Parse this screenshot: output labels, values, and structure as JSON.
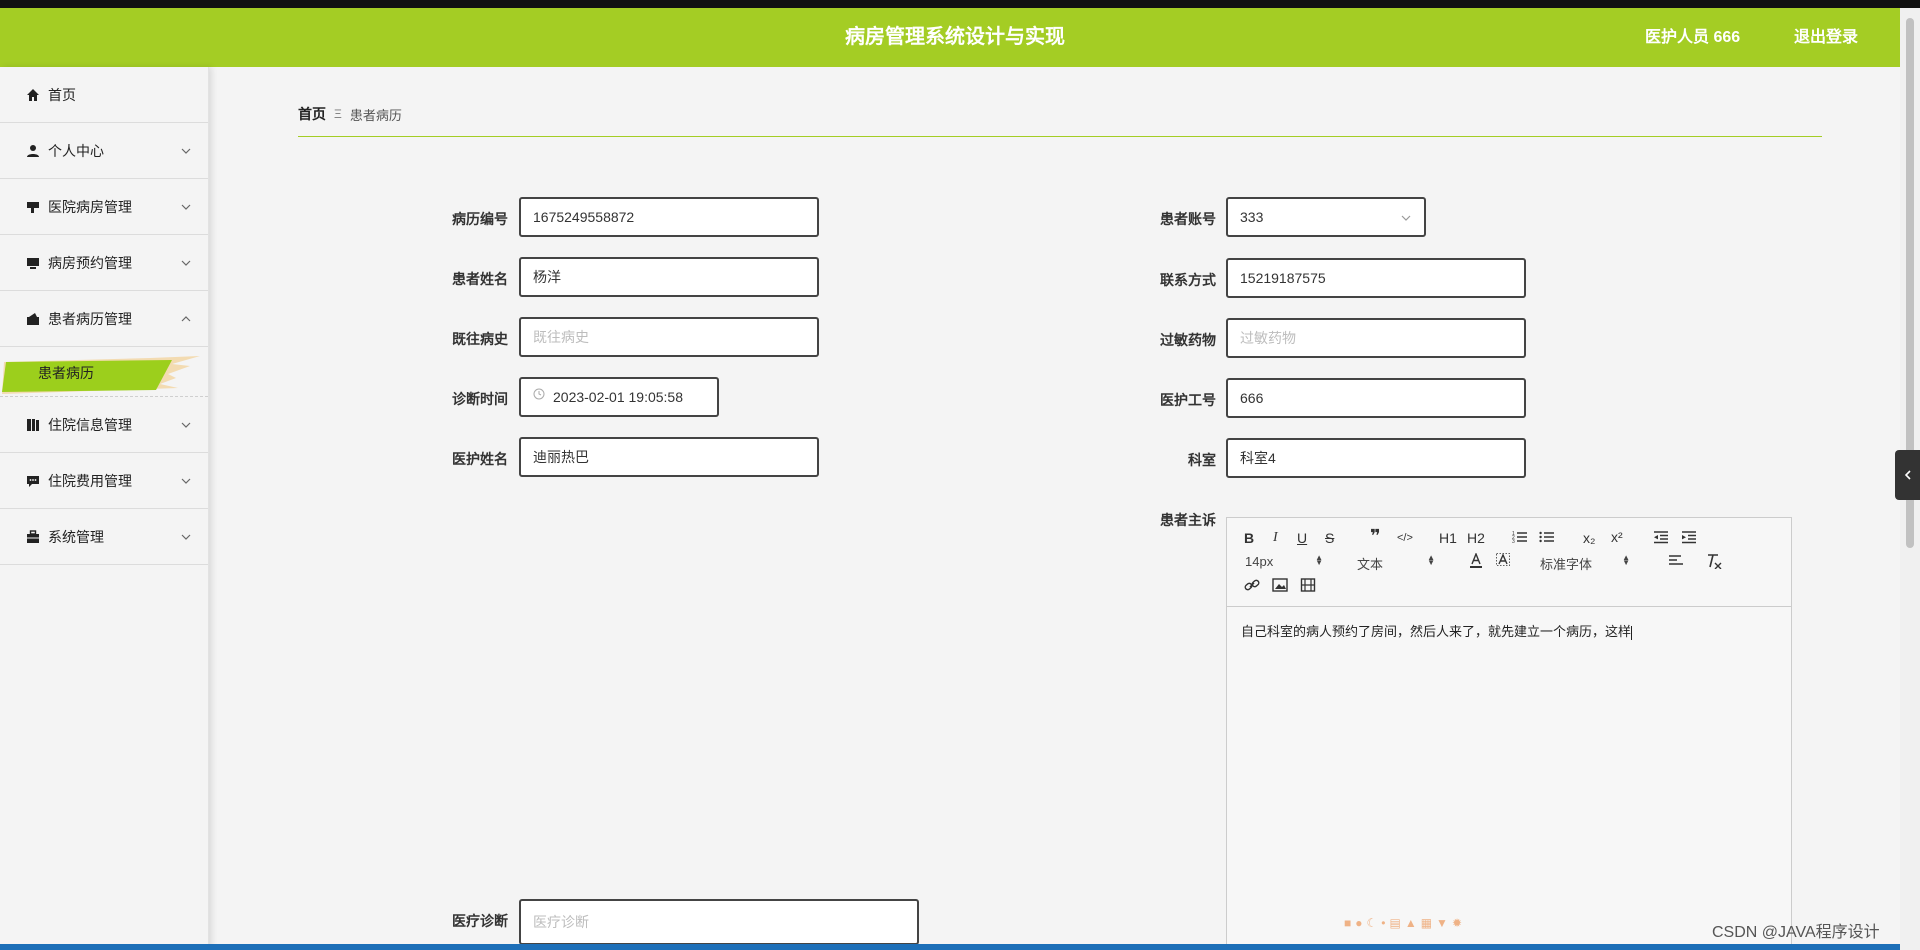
{
  "header": {
    "title": "病房管理系统设计与实现",
    "user": "医护人员 666",
    "logout": "退出登录"
  },
  "sidebar": {
    "items": [
      {
        "label": "首页",
        "icon": "home-icon"
      },
      {
        "label": "个人中心",
        "icon": "user-icon"
      },
      {
        "label": "医院病房管理",
        "icon": "flag-icon"
      },
      {
        "label": "病房预约管理",
        "icon": "monitor-icon"
      },
      {
        "label": "患者病历管理",
        "icon": "wallet-icon"
      },
      {
        "label": "住院信息管理",
        "icon": "book-icon"
      },
      {
        "label": "住院费用管理",
        "icon": "chat-icon"
      },
      {
        "label": "系统管理",
        "icon": "briefcase-icon"
      }
    ],
    "submenu_active": "患者病历"
  },
  "breadcrumb": {
    "home": "首页",
    "separator": "Ξ",
    "current": "患者病历"
  },
  "form": {
    "record_no": {
      "label": "病历编号",
      "value": "1675249558872"
    },
    "patient_name": {
      "label": "患者姓名",
      "value": "杨洋"
    },
    "history": {
      "label": "既往病史",
      "placeholder": "既往病史"
    },
    "diagnosis_time": {
      "label": "诊断时间",
      "value": "2023-02-01 19:05:58"
    },
    "nurse_name": {
      "label": "医护姓名",
      "value": "迪丽热巴"
    },
    "patient_account": {
      "label": "患者账号",
      "value": "333"
    },
    "contact": {
      "label": "联系方式",
      "value": "15219187575"
    },
    "allergy": {
      "label": "过敏药物",
      "placeholder": "过敏药物"
    },
    "nurse_id": {
      "label": "医护工号",
      "value": "666"
    },
    "department": {
      "label": "科室",
      "value": "科室4"
    },
    "complaint": {
      "label": "患者主诉",
      "content": "自己科室的病人预约了房间，然后人来了，就先建立一个病历，这样"
    },
    "medical_diagnosis": {
      "label": "医疗诊断",
      "placeholder": "医疗诊断"
    }
  },
  "editor_toolbar": {
    "size": "14px",
    "block": "文本",
    "font": "标准字体",
    "h1": "H1",
    "h2": "H2",
    "sub": "x₂",
    "sup": "x²"
  },
  "watermark": "CSDN @JAVA程序设计",
  "colors": {
    "accent": "#a4cd24",
    "active_submenu": "#9ccf1c"
  }
}
